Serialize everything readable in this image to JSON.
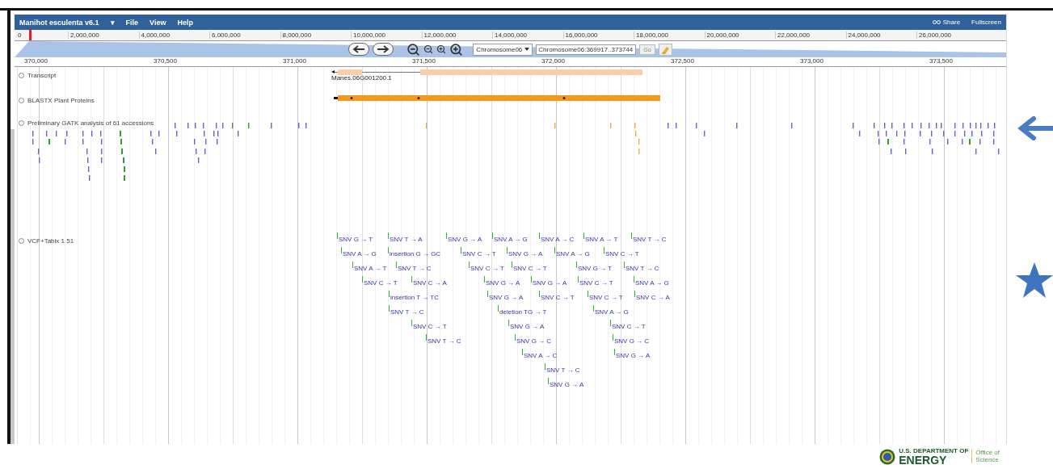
{
  "app": {
    "title": "Manihot esculenta v6.1",
    "title_caret": "▾",
    "menus": [
      "File",
      "View",
      "Help"
    ],
    "share": "Share",
    "fullscreen": "Fullscreen"
  },
  "overview": {
    "ticks": [
      "0",
      "2,000,000",
      "4,000,000",
      "6,000,000",
      "8,000,000",
      "10,000,000",
      "12,000,000",
      "14,000,000",
      "16,000,000",
      "18,000,000",
      "20,000,000",
      "22,000,000",
      "24,000,000",
      "26,000,000"
    ]
  },
  "navigation": {
    "reference": "Chromosome06",
    "location": "Chromosome06:369917..373744",
    "go": "Go"
  },
  "ruler": {
    "ticks": [
      "370,000",
      "370,500",
      "371,000",
      "371,500",
      "372,000",
      "372,500",
      "373,000",
      "373,500"
    ]
  },
  "tracks": [
    {
      "kind": "transcript",
      "label": "Transcript",
      "features": [
        {
          "name": "Manes.06G001200.1"
        }
      ]
    },
    {
      "kind": "protein",
      "label": "BLASTX Plant Proteins"
    },
    {
      "kind": "density",
      "label": "Preliminary GATK analysis of 61 accessions"
    },
    {
      "kind": "vcf",
      "label": "VCF+Tabix 1 51",
      "features": [
        {
          "label": "SNV G → T"
        },
        {
          "label": "SNV T → A"
        },
        {
          "label": "SNV G → A"
        },
        {
          "label": "SNV A → G"
        },
        {
          "label": "SNV A → C"
        },
        {
          "label": "SNV A → T"
        },
        {
          "label": "SNV T → C"
        },
        {
          "label": "SNV A → G"
        },
        {
          "label": "insertion G → GC"
        },
        {
          "label": "SNV C → T"
        },
        {
          "label": "SNV G → A"
        },
        {
          "label": "SNV A → G"
        },
        {
          "label": "SNV C → T"
        },
        {
          "label": "SNV A → T"
        },
        {
          "label": "SNV T → C"
        },
        {
          "label": "SNV C → T"
        },
        {
          "label": "SNV C → T"
        },
        {
          "label": "SNV G → T"
        },
        {
          "label": "SNV T → C"
        },
        {
          "label": "SNV C → T"
        },
        {
          "label": "SNV C → A"
        },
        {
          "label": "SNV G → A"
        },
        {
          "label": "SNV G → A"
        },
        {
          "label": "SNV C → T"
        },
        {
          "label": "SNV A → G"
        },
        {
          "label": "insertion T → TC"
        },
        {
          "label": "SNV G → A"
        },
        {
          "label": "SNV C → T"
        },
        {
          "label": "SNV C → T"
        },
        {
          "label": "SNV C → A"
        },
        {
          "label": "SNV T → C"
        },
        {
          "label": "deletion TG → T"
        },
        {
          "label": "SNV A → G"
        },
        {
          "label": "SNV C → T"
        },
        {
          "label": "SNV G → A"
        },
        {
          "label": "SNV C → T"
        },
        {
          "label": "SNV T → C"
        },
        {
          "label": "SNV G → C"
        },
        {
          "label": "SNV G → C"
        },
        {
          "label": "SNV A → C"
        },
        {
          "label": "SNV G → A"
        },
        {
          "label": "SNV T → C"
        },
        {
          "label": "SNV G → A"
        }
      ]
    }
  ],
  "logo": {
    "department": "U.S. DEPARTMENT OF",
    "name": "ENERGY",
    "office": "Office of",
    "office_2": "Science"
  }
}
